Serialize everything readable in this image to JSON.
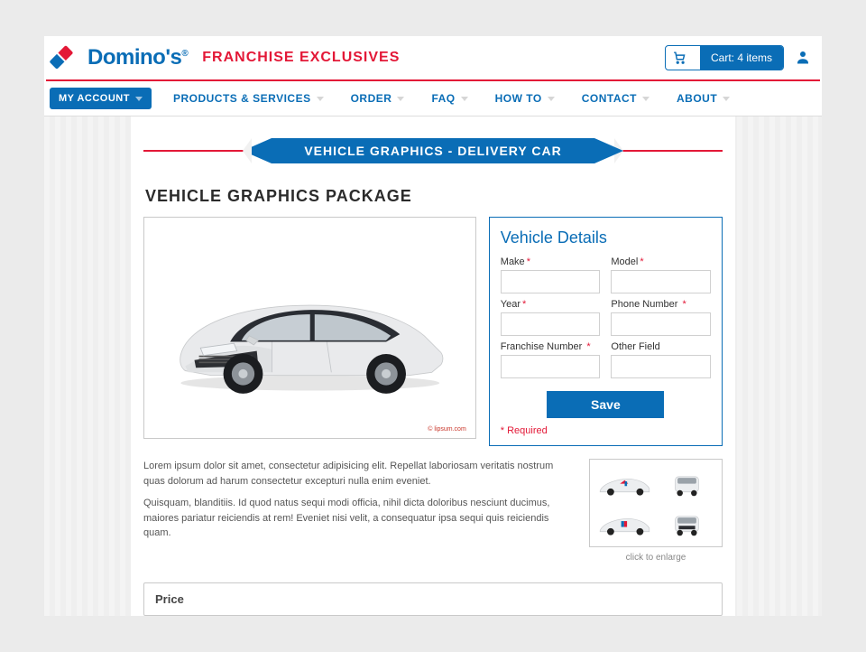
{
  "header": {
    "wordmark": "Domino's",
    "site_tag": "FRANCHISE EXCLUSIVES",
    "cart_label": "Cart: 4 items"
  },
  "nav": {
    "my_account": "MY ACCOUNT",
    "items": [
      {
        "label": "PRODUCTS & SERVICES"
      },
      {
        "label": "ORDER"
      },
      {
        "label": "FAQ"
      },
      {
        "label": "HOW TO"
      },
      {
        "label": "CONTACT"
      },
      {
        "label": "ABOUT"
      }
    ]
  },
  "banner": "VEHICLE GRAPHICS - DELIVERY CAR",
  "page_title": "VEHICLE GRAPHICS PACKAGE",
  "image_note": "© lipsum.com",
  "form": {
    "title": "Vehicle Details",
    "fields": {
      "make": {
        "label": "Make",
        "required": true
      },
      "model": {
        "label": "Model",
        "required": true
      },
      "year": {
        "label": "Year",
        "required": true
      },
      "phone": {
        "label": "Phone Number",
        "required": true
      },
      "franchise": {
        "label": "Franchise Number",
        "required": true
      },
      "other": {
        "label": "Other Field",
        "required": false
      }
    },
    "save": "Save",
    "required_note": "* Required"
  },
  "description": {
    "p1": "Lorem ipsum dolor sit amet, consectetur adipisicing elit. Repellat laboriosam veritatis nostrum quas dolorum ad harum consectetur excepturi nulla enim eveniet.",
    "p2": "Quisquam, blanditiis. Id quod natus sequi modi officia, nihil dicta doloribus nesciunt ducimus, maiores pariatur reiciendis at rem! Eveniet nisi velit, a consequatur ipsa sequi quis reiciendis quam."
  },
  "thumb_caption": "click to enlarge",
  "price_title": "Price"
}
